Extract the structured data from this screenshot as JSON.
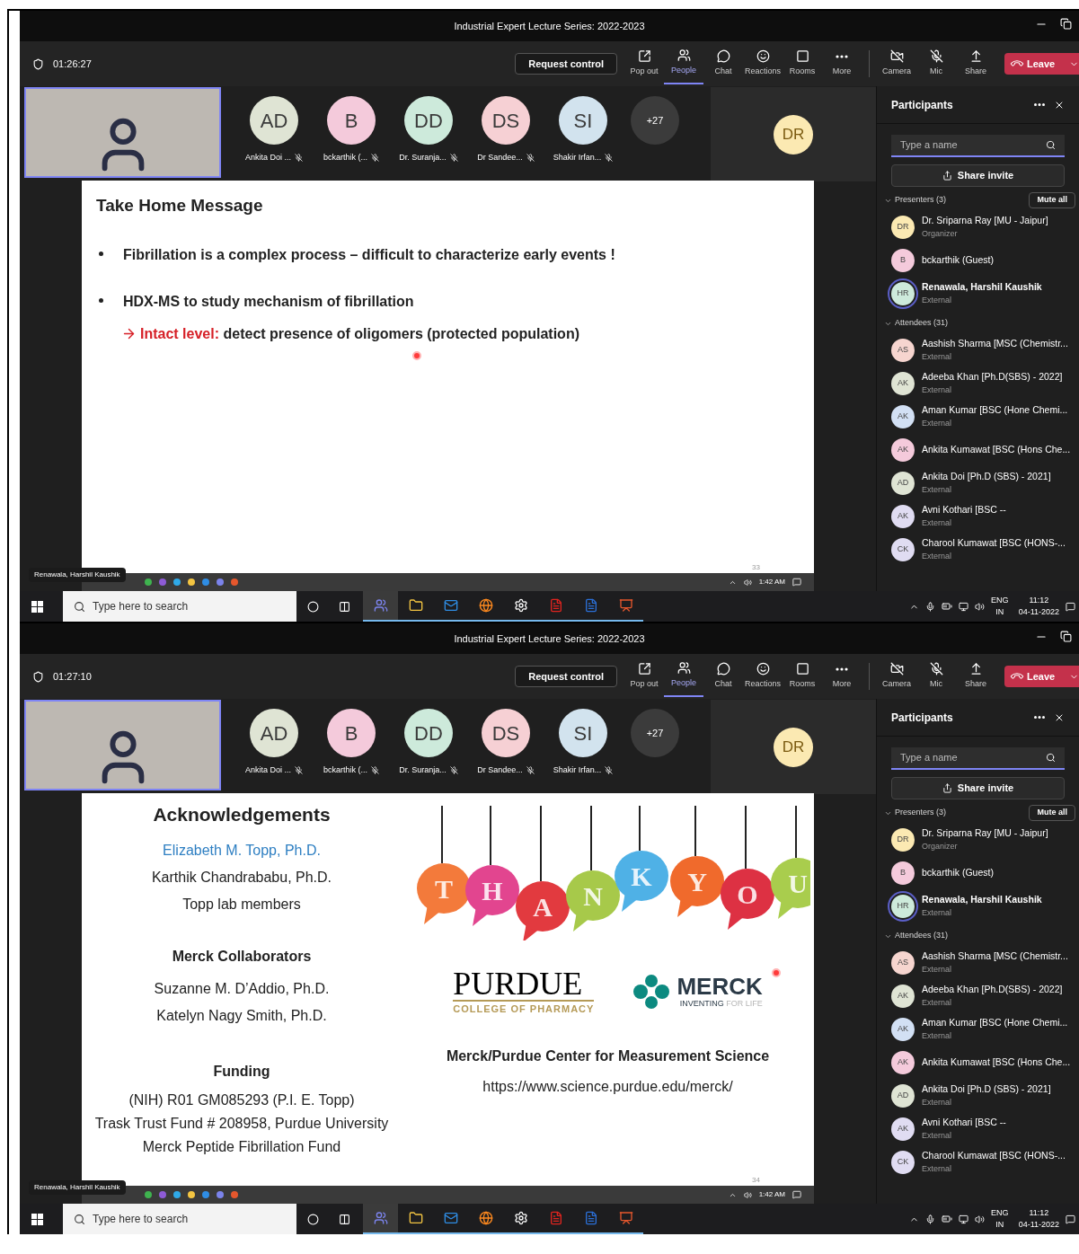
{
  "screens": [
    {
      "title": "Industrial Expert Lecture Series: 2022-2023",
      "timer": "01:26:27",
      "request_control": "Request control",
      "toolbar": [
        {
          "kind": "popout",
          "label": "Pop out",
          "selected": false
        },
        {
          "kind": "people",
          "label": "People",
          "selected": true
        },
        {
          "kind": "chat",
          "label": "Chat",
          "selected": false
        },
        {
          "kind": "reactions",
          "label": "Reactions",
          "selected": false
        },
        {
          "kind": "rooms",
          "label": "Rooms",
          "selected": false
        },
        {
          "kind": "more",
          "label": "More",
          "selected": false
        }
      ],
      "devices": [
        {
          "kind": "camera",
          "label": "Camera"
        },
        {
          "kind": "mic",
          "label": "Mic"
        },
        {
          "kind": "share",
          "label": "Share"
        }
      ],
      "leave": "Leave",
      "strip": {
        "participants": [
          {
            "initials": "AD",
            "name": "Ankita Doi ...",
            "color": "#dfe4d4"
          },
          {
            "initials": "B",
            "name": "bckarthik (...",
            "color": "#f4cadb"
          },
          {
            "initials": "DD",
            "name": "Dr. Suranja...",
            "color": "#cdeadb"
          },
          {
            "initials": "DS",
            "name": "Dr Sandee...",
            "color": "#f6d0d4"
          },
          {
            "initials": "SI",
            "name": "Shakir Irfan...",
            "color": "#d2e3ee"
          }
        ],
        "overflow": "+27",
        "spotlight": {
          "initials": "DR",
          "color": "#fbe9b2"
        }
      },
      "slide": {
        "kind": "bullets",
        "title": "Take Home Message",
        "bullets": [
          {
            "text": "Fibrillation is a complex process – difficult to characterize early events !"
          },
          {
            "text": "HDX-MS to study mechanism of fibrillation",
            "subpoints": [
              {
                "lead": "Intact level:",
                "text": "detect presence of oligomers (protected population)"
              }
            ]
          }
        ]
      },
      "slide_number": "33",
      "presenter_tag": "Renawala, Harshil Kaushik",
      "remote_clock": "1:42 AM",
      "panel": {
        "title": "Participants",
        "search_placeholder": "Type a name",
        "share_invite": "Share invite",
        "mute_all": "Mute all",
        "sections": [
          {
            "heading": "Presenters (3)",
            "people": [
              {
                "initials": "DR",
                "name": "Dr. Sriparna Ray [MU - Jaipur]",
                "role": "Organizer",
                "color": "#fbe9b2",
                "speaking": false
              },
              {
                "initials": "B",
                "name": "bckarthik (Guest)",
                "color": "#f4cadb",
                "speaking": false
              },
              {
                "initials": "HR",
                "name": "Renawala, Harshil Kaushik",
                "role": "External",
                "color": "#cdeadb",
                "speaking": true
              }
            ]
          },
          {
            "heading": "Attendees (31)",
            "people": [
              {
                "initials": "AS",
                "name": "Aashish Sharma [MSC (Chemistr...",
                "role": "External",
                "color": "#f6d5cf",
                "speaking": false
              },
              {
                "initials": "AK",
                "name": "Adeeba Khan [Ph.D(SBS) - 2022]",
                "role": "External",
                "color": "#dfe4d4",
                "speaking": false
              },
              {
                "initials": "AK",
                "name": "Aman Kumar [BSC (Hone Chemi...",
                "role": "External",
                "color": "#d2e0f4",
                "speaking": false
              },
              {
                "initials": "AK",
                "name": "Ankita Kumawat [BSC (Hons Che...",
                "color": "#f4cadb",
                "speaking": false
              },
              {
                "initials": "AD",
                "name": "Ankita Doi [Ph.D (SBS) - 2021]",
                "role": "External",
                "color": "#dfe4d4",
                "speaking": false
              },
              {
                "initials": "AK",
                "name": "Avni Kothari [BSC --",
                "role": "External",
                "color": "#e0dcf2",
                "speaking": false
              },
              {
                "initials": "CK",
                "name": "Charool Kumawat [BSC (HONS-...",
                "role": "External",
                "color": "#e0dcf2",
                "speaking": false
              }
            ]
          }
        ]
      },
      "taskbar": {
        "search_placeholder": "Type here to search",
        "apps": [
          {
            "kind": "teams",
            "selected": true
          },
          {
            "kind": "folder",
            "selected": false
          },
          {
            "kind": "mail",
            "selected": false
          },
          {
            "kind": "browser",
            "selected": false
          },
          {
            "kind": "settings",
            "selected": false
          },
          {
            "kind": "pdf",
            "selected": false
          },
          {
            "kind": "word",
            "selected": false
          },
          {
            "kind": "slides",
            "selected": false
          }
        ],
        "language": "ENG",
        "region": "IN",
        "time": "11:12",
        "date": "04-11-2022"
      }
    },
    {
      "title": "Industrial Expert Lecture Series: 2022-2023",
      "timer": "01:27:10",
      "request_control": "Request control",
      "toolbar": [
        {
          "kind": "popout",
          "label": "Pop out",
          "selected": false
        },
        {
          "kind": "people",
          "label": "People",
          "selected": true
        },
        {
          "kind": "chat",
          "label": "Chat",
          "selected": false
        },
        {
          "kind": "reactions",
          "label": "Reactions",
          "selected": false
        },
        {
          "kind": "rooms",
          "label": "Rooms",
          "selected": false
        },
        {
          "kind": "more",
          "label": "More",
          "selected": false
        }
      ],
      "devices": [
        {
          "kind": "camera",
          "label": "Camera"
        },
        {
          "kind": "mic",
          "label": "Mic"
        },
        {
          "kind": "share",
          "label": "Share"
        }
      ],
      "leave": "Leave",
      "strip": {
        "participants": [
          {
            "initials": "AD",
            "name": "Ankita Doi ...",
            "color": "#dfe4d4"
          },
          {
            "initials": "B",
            "name": "bckarthik (...",
            "color": "#f4cadb"
          },
          {
            "initials": "DD",
            "name": "Dr. Suranja...",
            "color": "#cdeadb"
          },
          {
            "initials": "DS",
            "name": "Dr Sandee...",
            "color": "#f6d0d4"
          },
          {
            "initials": "SI",
            "name": "Shakir Irfan...",
            "color": "#d2e3ee"
          }
        ],
        "overflow": "+27",
        "spotlight": {
          "initials": "DR",
          "color": "#fbe9b2"
        }
      },
      "slide": {
        "kind": "acknowledgements",
        "title": "Acknowledgements",
        "people": [
          {
            "text": "Elizabeth M. Topp, Ph.D.",
            "highlight": true
          },
          {
            "text": "Karthik Chandrababu, Ph.D.",
            "highlight": false
          },
          {
            "text": "Topp lab members",
            "highlight": false
          }
        ],
        "sections": [
          {
            "heading": "Merck Collaborators",
            "lines": [
              "Suzanne M. D’Addio, Ph.D.",
              "Katelyn Nagy Smith, Ph.D."
            ]
          },
          {
            "heading": "Funding",
            "lines": [
              "(NIH) R01 GM085293 (P.I. E. Topp)",
              "Trask Trust Fund # 208958, Purdue University",
              "Merck Peptide Fibrillation Fund"
            ]
          }
        ],
        "banner": [
          {
            "letter": "T",
            "color": "#f37a3b"
          },
          {
            "letter": "H",
            "color": "#e2458f"
          },
          {
            "letter": "A",
            "color": "#e23a3f"
          },
          {
            "letter": "N",
            "color": "#a7c94a"
          },
          {
            "letter": "K",
            "color": "#4fb1e6"
          },
          {
            "letter": "Y",
            "color": "#f06a2c"
          },
          {
            "letter": "O",
            "color": "#dd3143"
          },
          {
            "letter": "U",
            "color": "#a9cd4d"
          }
        ],
        "purdue": {
          "name": "PURDUE",
          "school": "COLLEGE OF PHARMACY"
        },
        "merck": {
          "name": "MERCK",
          "tagline": "INVENTING",
          "tagline_faint": "FOR LIFE"
        },
        "center": "Merck/Purdue Center for Measurement Science",
        "url": "https://www.science.purdue.edu/merck/"
      },
      "slide_number": "34",
      "presenter_tag": "Renawala, Harshil Kaushik",
      "remote_clock": "1:42 AM",
      "panel": {
        "title": "Participants",
        "search_placeholder": "Type a name",
        "share_invite": "Share invite",
        "mute_all": "Mute all",
        "sections": [
          {
            "heading": "Presenters (3)",
            "people": [
              {
                "initials": "DR",
                "name": "Dr. Sriparna Ray [MU - Jaipur]",
                "role": "Organizer",
                "color": "#fbe9b2",
                "speaking": false
              },
              {
                "initials": "B",
                "name": "bckarthik (Guest)",
                "color": "#f4cadb",
                "speaking": false
              },
              {
                "initials": "HR",
                "name": "Renawala, Harshil Kaushik",
                "role": "External",
                "color": "#cdeadb",
                "speaking": true
              }
            ]
          },
          {
            "heading": "Attendees (31)",
            "people": [
              {
                "initials": "AS",
                "name": "Aashish Sharma [MSC (Chemistr...",
                "role": "External",
                "color": "#f6d5cf",
                "speaking": false
              },
              {
                "initials": "AK",
                "name": "Adeeba Khan [Ph.D(SBS) - 2022]",
                "role": "External",
                "color": "#dfe4d4",
                "speaking": false
              },
              {
                "initials": "AK",
                "name": "Aman Kumar [BSC (Hone Chemi...",
                "role": "External",
                "color": "#d2e0f4",
                "speaking": false
              },
              {
                "initials": "AK",
                "name": "Ankita Kumawat [BSC (Hons Che...",
                "color": "#f4cadb",
                "speaking": false
              },
              {
                "initials": "AD",
                "name": "Ankita Doi [Ph.D (SBS) - 2021]",
                "role": "External",
                "color": "#dfe4d4",
                "speaking": false
              },
              {
                "initials": "AK",
                "name": "Avni Kothari [BSC --",
                "role": "External",
                "color": "#e0dcf2",
                "speaking": false
              },
              {
                "initials": "CK",
                "name": "Charool Kumawat [BSC (HONS-...",
                "role": "External",
                "color": "#e0dcf2",
                "speaking": false
              }
            ]
          }
        ]
      },
      "taskbar": {
        "search_placeholder": "Type here to search",
        "apps": [
          {
            "kind": "teams",
            "selected": true
          },
          {
            "kind": "folder",
            "selected": false
          },
          {
            "kind": "mail",
            "selected": false
          },
          {
            "kind": "browser",
            "selected": false
          },
          {
            "kind": "settings",
            "selected": false
          },
          {
            "kind": "pdf",
            "selected": false
          },
          {
            "kind": "word",
            "selected": false
          },
          {
            "kind": "slides",
            "selected": false
          }
        ],
        "language": "ENG",
        "region": "IN",
        "time": "11:12",
        "date": "04-11-2022"
      }
    }
  ]
}
